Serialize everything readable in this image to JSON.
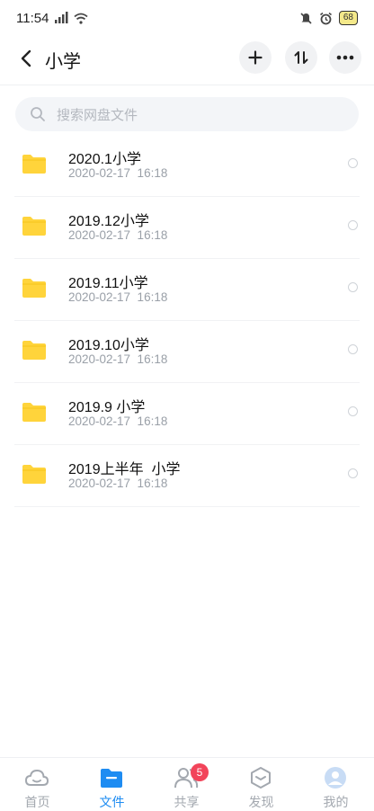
{
  "status_bar": {
    "time": "11:54",
    "battery": "68",
    "icons": [
      "signal-icon",
      "wifi-icon",
      "mute-icon",
      "alarm-icon",
      "battery-icon"
    ]
  },
  "header": {
    "title": "小学",
    "back_icon": "chevron-left-icon",
    "actions": [
      "plus-icon",
      "sort-icon",
      "more-icon"
    ]
  },
  "search": {
    "placeholder": "搜索网盘文件"
  },
  "files": [
    {
      "name": "2020.1小学",
      "date": "2020-02-17  16:18"
    },
    {
      "name": "2019.12小学",
      "date": "2020-02-17  16:18"
    },
    {
      "name": "2019.11小学",
      "date": "2020-02-17  16:18"
    },
    {
      "name": "2019.10小学",
      "date": "2020-02-17  16:18"
    },
    {
      "name": "2019.9 小学",
      "date": "2020-02-17  16:18"
    },
    {
      "name": "2019上半年  小学",
      "date": "2020-02-17  16:18"
    }
  ],
  "bottom_nav": {
    "items": [
      {
        "label": "首页",
        "icon": "home-cloud-icon",
        "active": false
      },
      {
        "label": "文件",
        "icon": "folder-icon",
        "active": true
      },
      {
        "label": "共享",
        "icon": "share-people-icon",
        "active": false,
        "badge": "5"
      },
      {
        "label": "发现",
        "icon": "discover-icon",
        "active": false
      },
      {
        "label": "我的",
        "icon": "profile-icon",
        "active": false
      }
    ]
  },
  "colors": {
    "accent": "#1e8cf2",
    "folder": "#ffd43b",
    "badge": "#f2445a"
  }
}
